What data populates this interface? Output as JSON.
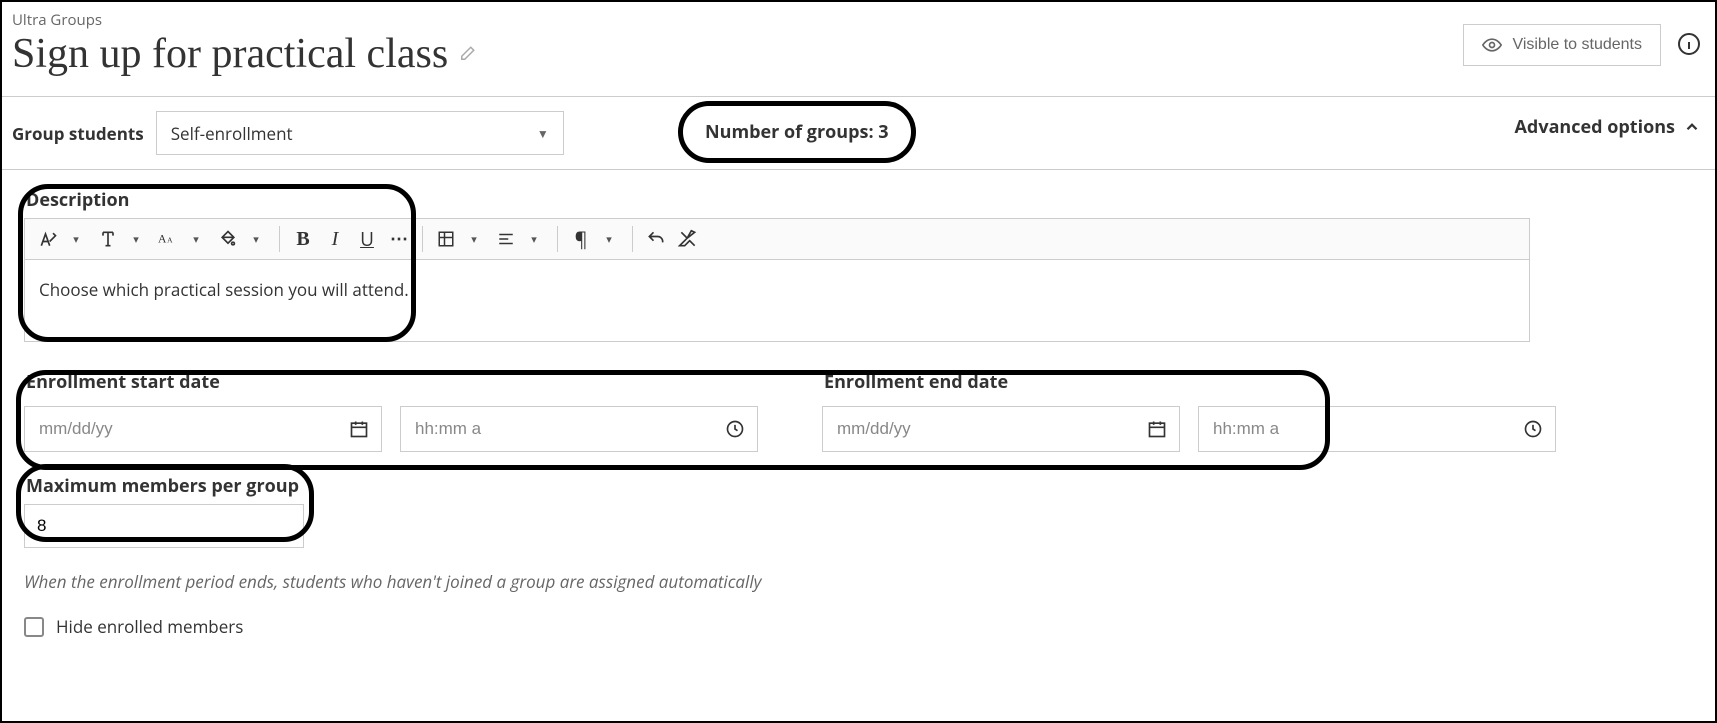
{
  "header": {
    "breadcrumb": "Ultra Groups",
    "title": "Sign up for practical class",
    "visibility_label": "Visible to students"
  },
  "settings": {
    "group_students_label": "Group students",
    "group_students_value": "Self-enrollment",
    "num_groups_text": "Number of groups: 3",
    "advanced_options_label": "Advanced options"
  },
  "description": {
    "label": "Description",
    "body": "Choose which practical session you will attend."
  },
  "enrollment": {
    "start_label": "Enrollment start date",
    "end_label": "Enrollment end date",
    "date_placeholder": "mm/dd/yy",
    "time_placeholder": "hh:mm a"
  },
  "max_members": {
    "label": "Maximum members per group",
    "value": "8"
  },
  "hint": "When the enrollment period ends, students who haven't joined a group are assigned automatically",
  "hide_enrolled_label": "Hide enrolled members"
}
